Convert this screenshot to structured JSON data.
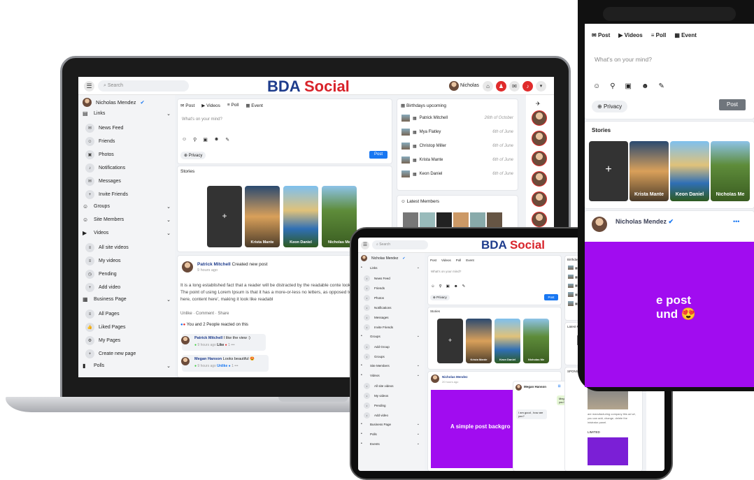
{
  "brand": {
    "first": "BDA",
    "second": "Social"
  },
  "search_placeholder": "Search",
  "user": {
    "name": "Nicholas",
    "full_name": "Nicholas Mendez"
  },
  "sidebar": [
    {
      "label": "Links",
      "icon": "links-icon",
      "kind": "section"
    },
    {
      "label": "News Feed",
      "icon": "news-icon"
    },
    {
      "label": "Friends",
      "icon": "friends-icon"
    },
    {
      "label": "Photos",
      "icon": "photos-icon"
    },
    {
      "label": "Notifications",
      "icon": "bell-icon"
    },
    {
      "label": "Messages",
      "icon": "message-icon"
    },
    {
      "label": "Invite Friends",
      "icon": "add-user-icon"
    },
    {
      "label": "Groups",
      "icon": "groups-icon",
      "kind": "section"
    },
    {
      "label": "Site Members",
      "icon": "members-icon",
      "kind": "section"
    },
    {
      "label": "Videos",
      "icon": "video-icon",
      "kind": "section"
    },
    {
      "label": "All site videos",
      "icon": "list-icon"
    },
    {
      "label": "My videos",
      "icon": "list-icon"
    },
    {
      "label": "Pending",
      "icon": "clock-icon"
    },
    {
      "label": "Add video",
      "icon": "plus-icon"
    },
    {
      "label": "Business Page",
      "icon": "building-icon",
      "kind": "section"
    },
    {
      "label": "All Pages",
      "icon": "list-icon"
    },
    {
      "label": "Liked Pages",
      "icon": "thumb-icon"
    },
    {
      "label": "My Pages",
      "icon": "gear-icon"
    },
    {
      "label": "Create new page",
      "icon": "plus-icon"
    },
    {
      "label": "Polls",
      "icon": "chart-icon",
      "kind": "section"
    }
  ],
  "tablet_sidebar": [
    {
      "label": "Links",
      "kind": "section"
    },
    {
      "label": "News Feed"
    },
    {
      "label": "Friends"
    },
    {
      "label": "Photos"
    },
    {
      "label": "Notifications"
    },
    {
      "label": "Messages"
    },
    {
      "label": "Invite Friends"
    },
    {
      "label": "Groups",
      "kind": "section"
    },
    {
      "label": "Add Group"
    },
    {
      "label": "Groups"
    },
    {
      "label": "Site Members",
      "kind": "section"
    },
    {
      "label": "Videos",
      "kind": "section"
    },
    {
      "label": "All site videos"
    },
    {
      "label": "My videos"
    },
    {
      "label": "Pending"
    },
    {
      "label": "Add video"
    },
    {
      "label": "Business Page",
      "kind": "section"
    },
    {
      "label": "Polls",
      "kind": "section"
    },
    {
      "label": "Events",
      "kind": "section"
    }
  ],
  "composer": {
    "tabs": [
      "Post",
      "Videos",
      "Poll",
      "Event"
    ],
    "placeholder": "What's on your mind?",
    "privacy": "Privacy",
    "post_button": "Post"
  },
  "stories": {
    "title": "Stories",
    "names": [
      "Krista Mante",
      "Keon Daniel",
      "Nicholas Me"
    ]
  },
  "post": {
    "author": "Patrick Mitchell",
    "action": "Created new post",
    "time": "9 hours ago",
    "body": "It is a long established fact that a reader will be distracted by the readable conte looking at its layout. The point of using Lorem Ipsum is that it has a more-or-less no letters, as opposed to using 'Content here, content here', making it look like readabl",
    "actions": [
      "Unlike",
      "Comment",
      "Share"
    ],
    "reactions": "You and 2 People reacted on this"
  },
  "comments": [
    {
      "author": "Patrick Mitchell",
      "text": "I like the view :)",
      "time": "9 hours ago",
      "like": "Like",
      "count": "1"
    },
    {
      "author": "Megan Hanson",
      "text": "Looks beautiful",
      "time": "9 hours ago",
      "like": "Unlike",
      "count": "1"
    }
  ],
  "birthdays": {
    "title": "Birthdays upcoming",
    "items": [
      {
        "name": "Patrick Mitchell",
        "date": "26th of October"
      },
      {
        "name": "Mya Flatley",
        "date": "6th of June"
      },
      {
        "name": "Christop Miller",
        "date": "6th of June"
      },
      {
        "name": "Krista Mante",
        "date": "6th of June"
      },
      {
        "name": "Keon Daniel",
        "date": "6th of June"
      }
    ]
  },
  "latest_members": "Latest Members",
  "sponsored": "SPONSORED",
  "sponsored_text": "are manufacturing company this ad wt, you can add, change, delete the inistrator panel.",
  "limited": "LIMITED",
  "tablet_post": {
    "author": "Nicholas Mendez",
    "time": "20 hours ago",
    "bg_text": "A simple post backgro"
  },
  "chat": {
    "name": "Megan Hanson",
    "incoming": "Megan How are you?",
    "outgoing": "I am good , how are you?"
  },
  "phone_post": {
    "author": "Nicholas Mendez",
    "bg_text_1": "e post",
    "bg_text_2": "und"
  },
  "colors": {
    "brand_blue": "#1e3c8c",
    "brand_red": "#d8232a",
    "accent": "#1877f2",
    "purple": "#a10cf0"
  }
}
